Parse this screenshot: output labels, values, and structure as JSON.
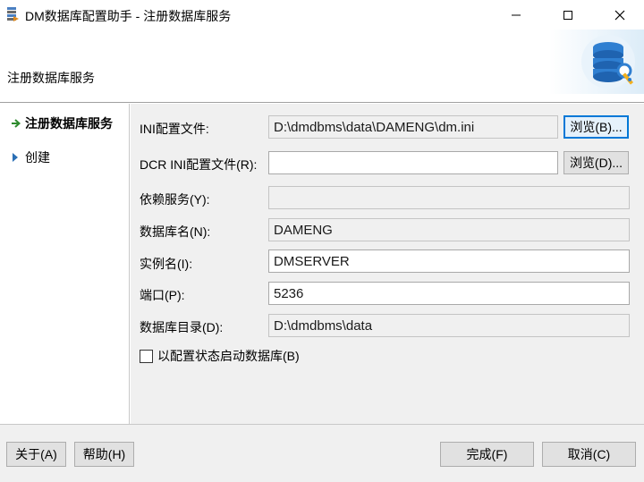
{
  "window": {
    "title": "DM数据库配置助手 - 注册数据库服务",
    "minimize_icon": "minimize-icon",
    "maximize_icon": "maximize-icon",
    "close_icon": "close-icon"
  },
  "header": {
    "title": "注册数据库服务",
    "art_icon": "database-settings-icon"
  },
  "nav": {
    "items": [
      {
        "label": "注册数据库服务",
        "marker": "arrow-right-icon",
        "active": true
      },
      {
        "label": "创建",
        "marker": "triangle-right-icon",
        "active": false
      }
    ]
  },
  "form": {
    "ini_file": {
      "label": "INI配置文件:",
      "value": "D:\\dmdbms\\data\\DAMENG\\dm.ini",
      "browse": "浏览(B)..."
    },
    "dcr_ini_file": {
      "label": "DCR INI配置文件(R):",
      "value": "",
      "browse": "浏览(D)..."
    },
    "dependent_service": {
      "label": "依赖服务(Y):",
      "value": ""
    },
    "db_name": {
      "label": "数据库名(N):",
      "value": "DAMENG"
    },
    "instance_name": {
      "label": "实例名(I):",
      "value": "DMSERVER"
    },
    "port": {
      "label": "端口(P):",
      "value": "5236"
    },
    "db_dir": {
      "label": "数据库目录(D):",
      "value": "D:\\dmdbms\\data"
    },
    "start_config_checkbox": {
      "label": "以配置状态启动数据库(B)",
      "checked": false
    }
  },
  "footer": {
    "about": "关于(A)",
    "help": "帮助(H)",
    "finish": "完成(F)",
    "cancel": "取消(C)"
  },
  "colors": {
    "accent": "#0078d7",
    "nav_arrow": "#2e8b2e",
    "nav_triangle": "#2a6fb5"
  }
}
